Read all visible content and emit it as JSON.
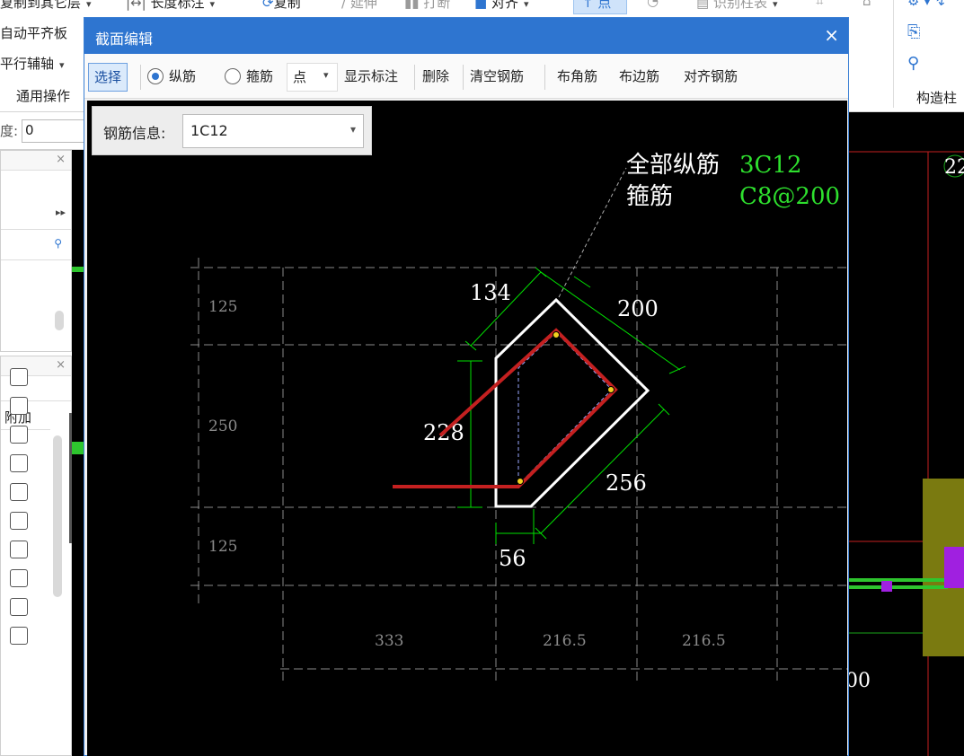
{
  "ribbon": {
    "row1": {
      "copy_to_layer": "复制到其它层",
      "length_mark": "长度标注",
      "copy": "复制",
      "extend": "延伸",
      "break": "打断",
      "align": "对齐",
      "point": "点",
      "identify_column_table": "识别柱表"
    },
    "auto_flush_slab": "自动平齐板",
    "parallel_axis": "平行辅轴",
    "common_ops": "通用操作",
    "construct_column": "构造柱"
  },
  "depth": {
    "label": "度:",
    "value": "0"
  },
  "left_panel": {
    "column_header": "附加",
    "checkbox_count": 10
  },
  "dialog": {
    "title": "截面编辑",
    "toolbar": {
      "select": "选择",
      "longitudinal": "纵筋",
      "stirrup": "箍筋",
      "point_mode": "点",
      "show_annotation": "显示标注",
      "delete": "删除",
      "clear_rebar": "清空钢筋",
      "corner_rebar": "布角筋",
      "edge_rebar": "布边筋",
      "align_rebar": "对齐钢筋"
    },
    "rebar_info": {
      "label": "钢筋信息:",
      "value": "1C12"
    }
  },
  "drawing": {
    "annotation": {
      "all_long_label": "全部纵筋",
      "all_long_value": "3C12",
      "stirrup_label": "箍筋",
      "stirrup_value": "C8@200"
    },
    "dims": {
      "d134": "134",
      "d200": "200",
      "d228": "228",
      "d256": "256",
      "d56": "56"
    },
    "grid_left": [
      "125",
      "250",
      "125"
    ],
    "grid_bottom": [
      "333",
      "216.5",
      "216.5"
    ],
    "right_partial_top": "22",
    "right_partial_bottom": "00"
  },
  "colors": {
    "dialog_title": "#2e75d0",
    "dimension": "#00e000",
    "section": "#ffffff",
    "highlight_rebar": "#c42020",
    "grid": "#8a8a8a"
  }
}
